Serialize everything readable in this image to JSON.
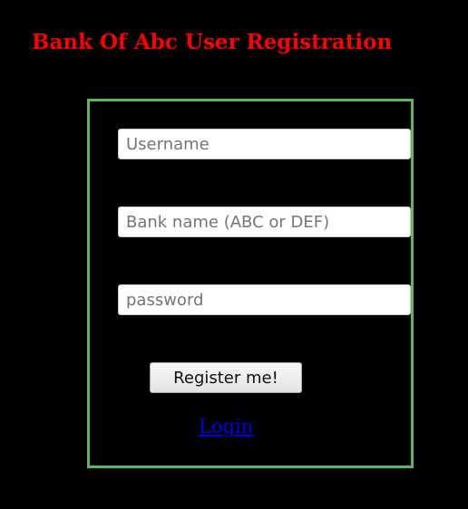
{
  "page": {
    "title": "Bank Of Abc User Registration",
    "title_color": "#ff0000",
    "background_color": "#000000"
  },
  "form": {
    "border_color": "#5cb85c",
    "username": {
      "placeholder": "Username",
      "value": ""
    },
    "bank_name": {
      "placeholder": "Bank name (ABC or DEF)",
      "value": ""
    },
    "password": {
      "placeholder": "password",
      "value": ""
    },
    "register_label": "Register me!",
    "login_link_label": "Login",
    "link_color": "#0000ee"
  }
}
